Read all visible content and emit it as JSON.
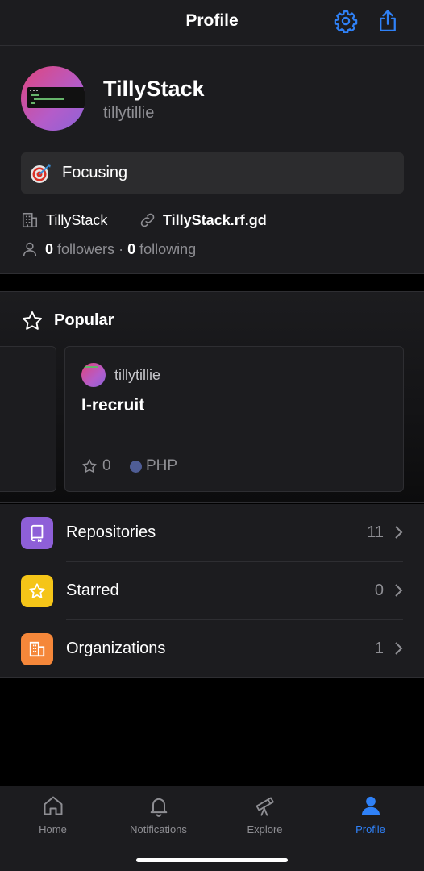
{
  "header": {
    "title": "Profile",
    "settings_icon": "gear-icon",
    "share_icon": "share-icon"
  },
  "profile": {
    "display_name": "TillyStack",
    "username": "tillytillie",
    "status": {
      "emoji": "direct-hit-target-icon",
      "text": "Focusing"
    },
    "company": "TillyStack",
    "website": "TillyStack.rf.gd",
    "followers_count": "0",
    "followers_label": "followers",
    "separator": "·",
    "following_count": "0",
    "following_label": "following"
  },
  "popular": {
    "title": "Popular",
    "repos": [
      {
        "owner": "tillytillie",
        "name": "I-recruit",
        "stars": "0",
        "language": "PHP",
        "language_color": "#4f5d95"
      }
    ]
  },
  "menu": [
    {
      "label": "Repositories",
      "count": "11",
      "icon": "repo-icon",
      "color": "#8e5fd8"
    },
    {
      "label": "Starred",
      "count": "0",
      "icon": "star-icon",
      "color": "#f5c518"
    },
    {
      "label": "Organizations",
      "count": "1",
      "icon": "organization-icon",
      "color": "#f5873a"
    }
  ],
  "tabs": [
    {
      "label": "Home",
      "icon": "home-icon"
    },
    {
      "label": "Notifications",
      "icon": "bell-icon"
    },
    {
      "label": "Explore",
      "icon": "telescope-icon"
    },
    {
      "label": "Profile",
      "icon": "person-icon",
      "active": true
    }
  ],
  "colors": {
    "accent": "#2f81f7",
    "background": "#000000",
    "surface": "#1c1c1f"
  }
}
